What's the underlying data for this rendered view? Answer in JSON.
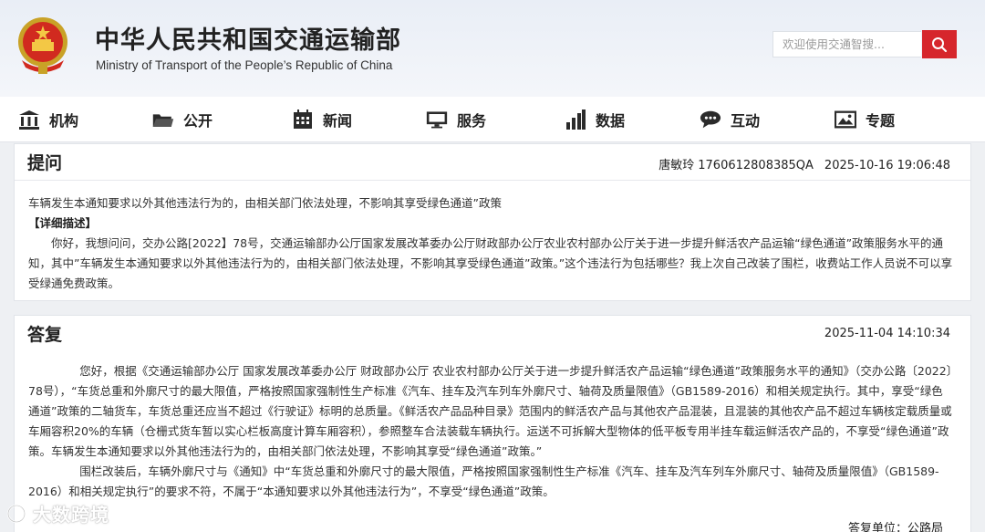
{
  "header": {
    "title_cn": "中华人民共和国交通运输部",
    "title_en": "Ministry of Transport of the People’s Republic of China",
    "search_placeholder": "欢迎使用交通智搜..."
  },
  "nav": {
    "items": [
      {
        "label": "机构",
        "icon": "building-icon"
      },
      {
        "label": "公开",
        "icon": "folder-icon"
      },
      {
        "label": "新闻",
        "icon": "calendar-icon"
      },
      {
        "label": "服务",
        "icon": "monitor-icon"
      },
      {
        "label": "数据",
        "icon": "bar-chart-icon"
      },
      {
        "label": "互动",
        "icon": "chat-bubble-icon"
      },
      {
        "label": "专题",
        "icon": "image-icon"
      }
    ]
  },
  "question": {
    "title": "提问",
    "author": "唐敏玲",
    "id": "1760612808385QA",
    "datetime": "2025-10-16 19:06:48",
    "subject": "车辆发生本通知要求以外其他违法行为的，由相关部门依法处理，不影响其享受绿色通道”政策",
    "detail_label": "【详细描述】",
    "detail": "你好，我想问问，交办公路[2022】78号，交通运输部办公厅国家发展改革委办公厅财政部办公厅农业农村部办公厅关于进一步提升鲜活农产品运输“绿色通道”政策服务水平的通知，其中”车辆发生本通知要求以外其他违法行为的，由相关部门依法处理，不影响其享受绿色通道”政策。”这个违法行为包括哪些？我上次自己改装了围栏，收费站工作人员说不可以享受绿通免费政策。"
  },
  "answer": {
    "title": "答复",
    "datetime": "2025-11-04 14:10:34",
    "paragraph1": "您好，根据《交通运输部办公厅 国家发展改革委办公厅 财政部办公厅 农业农村部办公厅关于进一步提升鲜活农产品运输“绿色通道”政策服务水平的通知》（交办公路〔2022〕78号），“车货总重和外廓尺寸的最大限值，严格按照国家强制性生产标准《汽车、挂车及汽车列车外廓尺寸、轴荷及质量限值》（GB1589-2016）和相关规定执行。其中，享受“绿色通道”政策的二轴货车，车货总重还应当不超过《行驶证》标明的总质量。《鲜活农产品品种目录》范围内的鲜活农产品与其他农产品混装，且混装的其他农产品不超过车辆核定载质量或车厢容积20%的车辆（仓栅式货车暂以实心栏板高度计算车厢容积），参照整车合法装载车辆执行。运送不可拆解大型物体的低平板专用半挂车载运鲜活农产品的，不享受“绿色通道”政策。车辆发生本通知要求以外其他违法行为的，由相关部门依法处理，不影响其享受“绿色通道”政策。”",
    "paragraph2": "围栏改装后，车辆外廓尺寸与《通知》中“车货总重和外廓尺寸的最大限值，严格按照国家强制性生产标准《汽车、挂车及汽车列车外廓尺寸、轴荷及质量限值》（GB1589-2016）和相关规定执行”的要求不符，不属于“本通知要求以外其他违法行为”，不享受“绿色通道”政策。",
    "unit_label": "答复单位：公路局"
  },
  "watermark": {
    "text": "大数跨境"
  },
  "colors": {
    "accent_red": "#d6262c",
    "nav_icon": "#2b2b2b"
  }
}
